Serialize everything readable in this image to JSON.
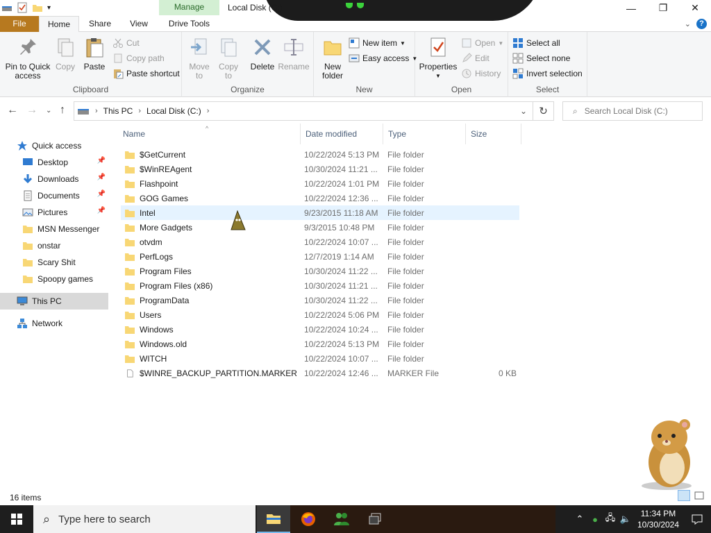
{
  "titlebar": {
    "contextual_tab": "Manage",
    "title": "Local Disk (C:)"
  },
  "tabs": {
    "file": "File",
    "home": "Home",
    "share": "Share",
    "view": "View",
    "drive_tools": "Drive Tools"
  },
  "ribbon": {
    "clipboard": {
      "label": "Clipboard",
      "pin_l1": "Pin to Quick",
      "pin_l2": "access",
      "copy": "Copy",
      "paste": "Paste",
      "cut": "Cut",
      "copy_path": "Copy path",
      "paste_shortcut": "Paste shortcut"
    },
    "organize": {
      "label": "Organize",
      "move_l1": "Move",
      "move_l2": "to",
      "copy_l1": "Copy",
      "copy_l2": "to",
      "delete": "Delete",
      "rename": "Rename"
    },
    "new": {
      "label": "New",
      "folder_l1": "New",
      "folder_l2": "folder",
      "new_item": "New item",
      "easy_access": "Easy access"
    },
    "open": {
      "label": "Open",
      "properties": "Properties",
      "open": "Open",
      "edit": "Edit",
      "history": "History"
    },
    "select": {
      "label": "Select",
      "select_all": "Select all",
      "select_none": "Select none",
      "invert": "Invert selection"
    }
  },
  "address": {
    "crumbs": [
      "This PC",
      "Local Disk (C:)"
    ],
    "search_placeholder": "Search Local Disk (C:)"
  },
  "sidebar": {
    "items": [
      {
        "label": "Quick access",
        "icon": "star-icon",
        "pinned": false
      },
      {
        "label": "Desktop",
        "icon": "desktop-icon",
        "pinned": true
      },
      {
        "label": "Downloads",
        "icon": "download-icon",
        "pinned": true
      },
      {
        "label": "Documents",
        "icon": "documents-icon",
        "pinned": true
      },
      {
        "label": "Pictures",
        "icon": "pictures-icon",
        "pinned": true
      },
      {
        "label": "MSN Messenger",
        "icon": "folder-icon",
        "pinned": false
      },
      {
        "label": "onstar",
        "icon": "folder-icon",
        "pinned": false
      },
      {
        "label": "Scary Shit",
        "icon": "folder-icon",
        "pinned": false
      },
      {
        "label": "Spoopy games",
        "icon": "folder-icon",
        "pinned": false
      },
      {
        "label": "This PC",
        "icon": "computer-icon",
        "pinned": false
      },
      {
        "label": "Network",
        "icon": "network-icon",
        "pinned": false
      }
    ]
  },
  "columns": {
    "name": "Name",
    "date": "Date modified",
    "type": "Type",
    "size": "Size"
  },
  "files": [
    {
      "name": "$GetCurrent",
      "date": "10/22/2024 5:13 PM",
      "type": "File folder",
      "size": ""
    },
    {
      "name": "$WinREAgent",
      "date": "10/30/2024 11:21 ...",
      "type": "File folder",
      "size": ""
    },
    {
      "name": "Flashpoint",
      "date": "10/22/2024 1:01 PM",
      "type": "File folder",
      "size": ""
    },
    {
      "name": "GOG Games",
      "date": "10/22/2024 12:36 ...",
      "type": "File folder",
      "size": ""
    },
    {
      "name": "Intel",
      "date": "9/23/2015 11:18 AM",
      "type": "File folder",
      "size": ""
    },
    {
      "name": "More Gadgets",
      "date": "9/3/2015 10:48 PM",
      "type": "File folder",
      "size": ""
    },
    {
      "name": "otvdm",
      "date": "10/22/2024 10:07 ...",
      "type": "File folder",
      "size": ""
    },
    {
      "name": "PerfLogs",
      "date": "12/7/2019 1:14 AM",
      "type": "File folder",
      "size": ""
    },
    {
      "name": "Program Files",
      "date": "10/30/2024 11:22 ...",
      "type": "File folder",
      "size": ""
    },
    {
      "name": "Program Files (x86)",
      "date": "10/30/2024 11:21 ...",
      "type": "File folder",
      "size": ""
    },
    {
      "name": "ProgramData",
      "date": "10/30/2024 11:22 ...",
      "type": "File folder",
      "size": ""
    },
    {
      "name": "Users",
      "date": "10/22/2024 5:06 PM",
      "type": "File folder",
      "size": ""
    },
    {
      "name": "Windows",
      "date": "10/22/2024 10:24 ...",
      "type": "File folder",
      "size": ""
    },
    {
      "name": "Windows.old",
      "date": "10/22/2024 5:13 PM",
      "type": "File folder",
      "size": ""
    },
    {
      "name": "WITCH",
      "date": "10/22/2024 10:07 ...",
      "type": "File folder",
      "size": ""
    },
    {
      "name": "$WINRE_BACKUP_PARTITION.MARKER",
      "date": "10/22/2024 12:46 ...",
      "type": "MARKER File",
      "size": "0 KB"
    }
  ],
  "status": {
    "count": "16 items"
  },
  "taskbar": {
    "search_placeholder": "Type here to search",
    "time": "11:34 PM",
    "date": "10/30/2024"
  },
  "colors": {
    "file_tab": "#b7791f",
    "manage_tab": "#d3efd3",
    "folder": "#f8d775",
    "hover_row": "#e5f3ff",
    "accent": "#1a73c8"
  }
}
